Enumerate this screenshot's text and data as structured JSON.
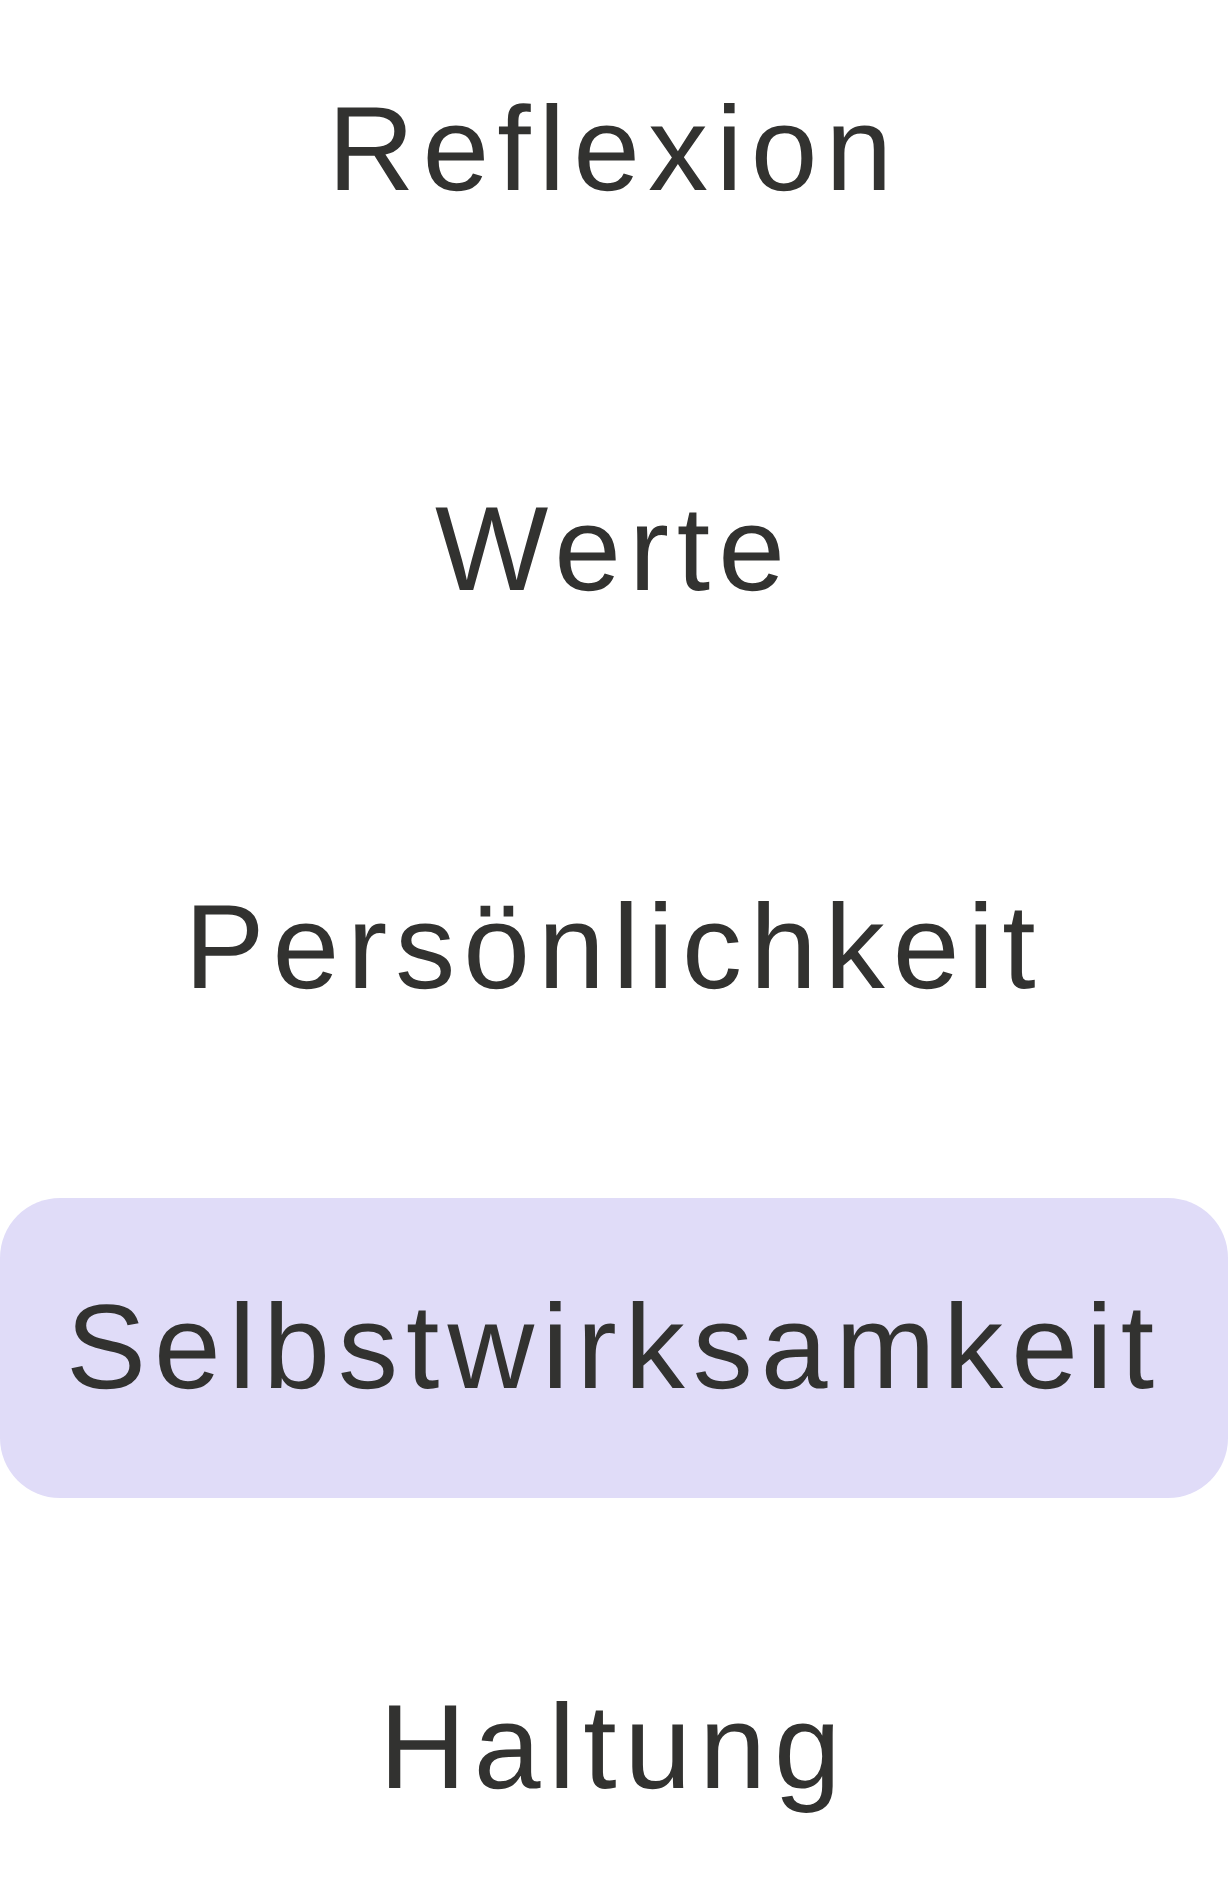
{
  "menu": {
    "items": [
      {
        "label": "Reflexion",
        "selected": false
      },
      {
        "label": "Werte",
        "selected": false
      },
      {
        "label": "Persönlichkeit",
        "selected": false
      },
      {
        "label": "Selbstwirksamkeit",
        "selected": true
      },
      {
        "label": "Haltung",
        "selected": false
      }
    ]
  }
}
